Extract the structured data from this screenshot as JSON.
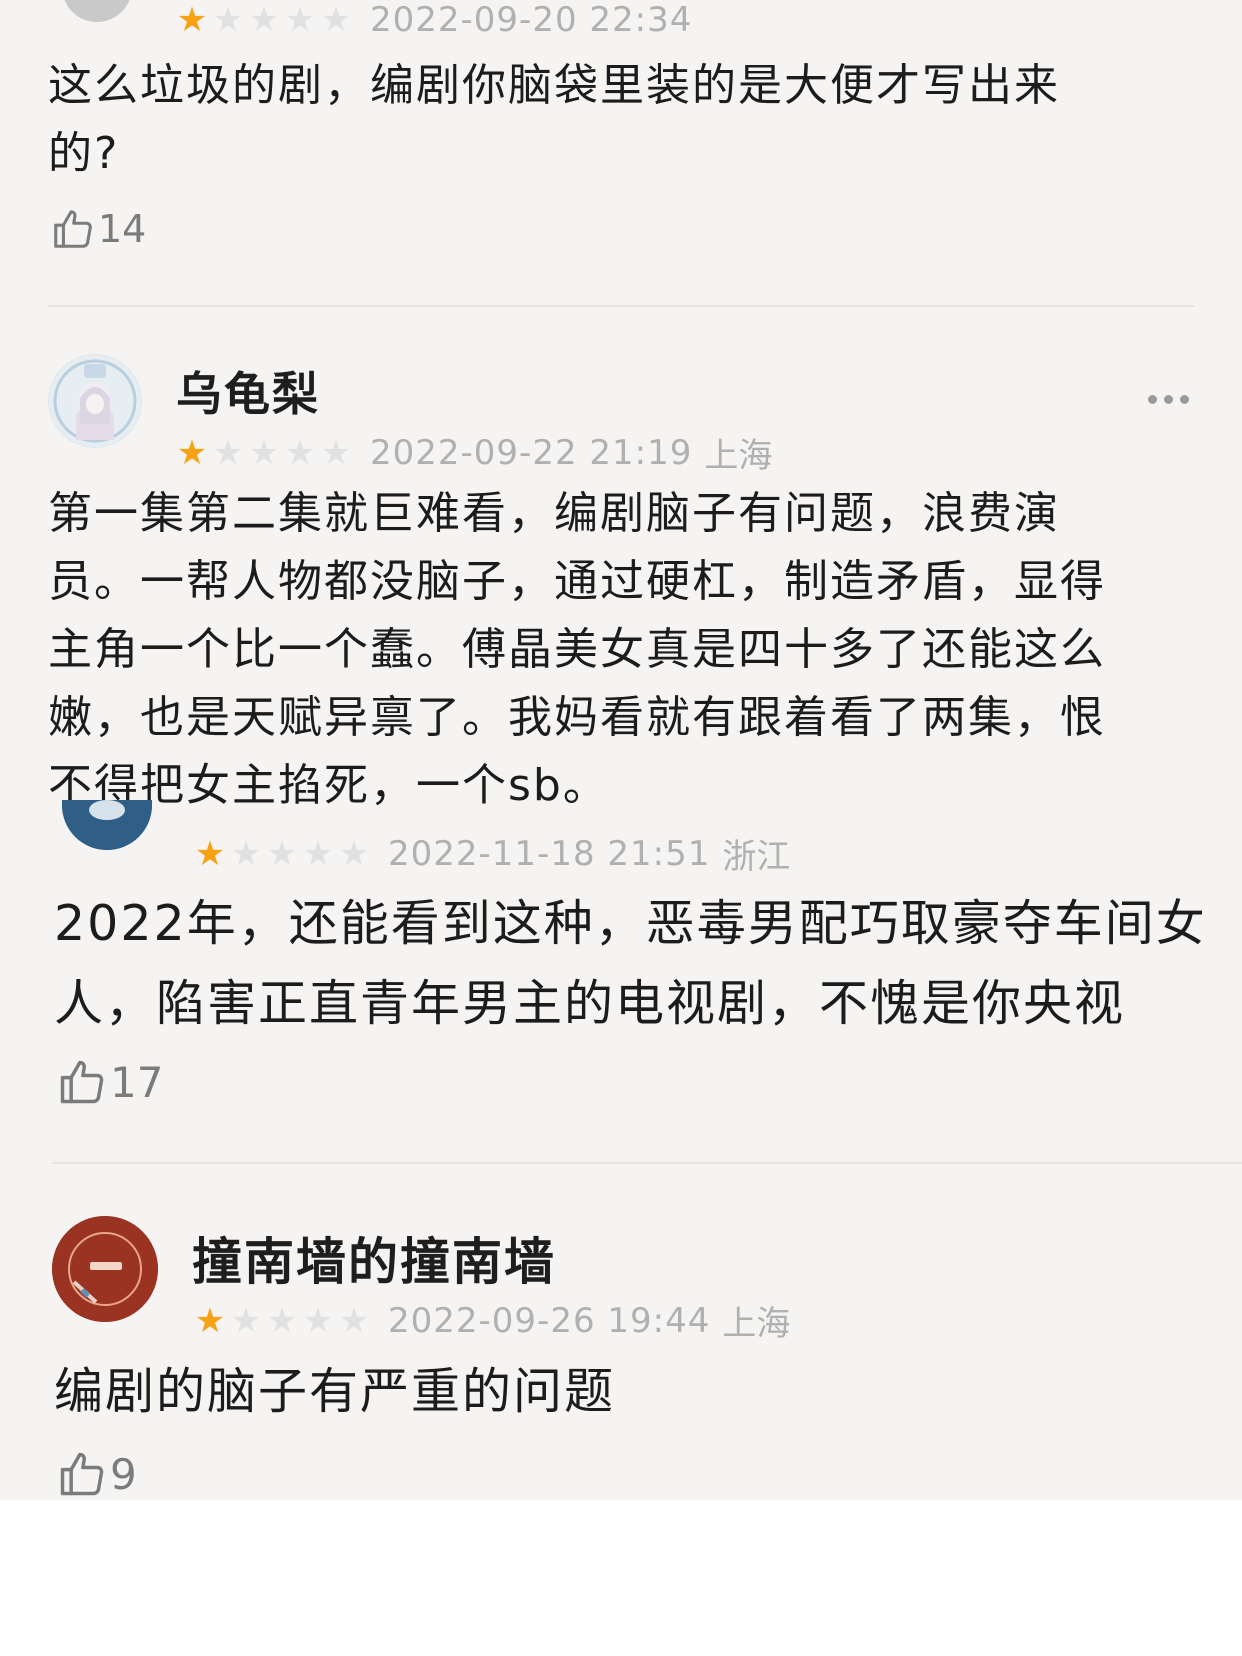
{
  "comments": [
    {
      "username": "",
      "rating": 1,
      "date": "2022-09-20 22:34",
      "location": "",
      "lines": [
        "这么垃圾的剧，编剧你脑袋里装的是大便才写出来",
        "的?"
      ],
      "likes": "14"
    },
    {
      "username": "乌龟梨",
      "rating": 1,
      "date": "2022-09-22 21:19",
      "location": "上海",
      "lines": [
        "第一集第二集就巨难看，编剧脑子有问题，浪费演",
        "员。一帮人物都没脑子，通过硬杠，制造矛盾，显得",
        "主角一个比一个蠢。傅晶美女真是四十多了还能这么",
        "嫩，也是天赋异禀了。我妈看就有跟着看了两集，恨",
        "不得把女主掐死，一个sb。"
      ],
      "more_icon": "more-dots-icon"
    },
    {
      "username": "",
      "rating": 1,
      "date": "2022-11-18 21:51",
      "location": "浙江",
      "lines": [
        "2022年，还能看到这种，恶毒男配巧取豪夺车间女",
        "人，陷害正直青年男主的电视剧，不愧是你央视"
      ],
      "likes": "17"
    },
    {
      "username": "撞南墙的撞南墙",
      "rating": 1,
      "date": "2022-09-26 19:44",
      "location": "上海",
      "lines": [
        "编剧的脑子有严重的问题"
      ],
      "likes": "9"
    }
  ],
  "icons": {
    "like": "thumbs-up-icon",
    "star": "star-icon",
    "more": "more-dots-icon"
  },
  "colors": {
    "star_on": "#f6a214",
    "star_off": "#e1e1e1",
    "meta_text": "#b0b0b0",
    "background": "#f5f4f3"
  }
}
